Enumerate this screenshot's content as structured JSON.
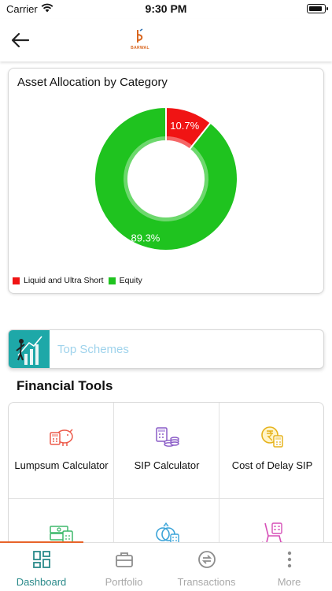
{
  "status": {
    "carrier": "Carrier",
    "time": "9:30 PM"
  },
  "header": {
    "logo_text": "BARWAL",
    "back_icon": "arrow-left-icon"
  },
  "chart_card": {
    "title": "Asset Allocation by Category"
  },
  "chart_data": {
    "type": "pie",
    "title": "Asset Allocation by Category",
    "categories": [
      "Liquid and Ultra Short",
      "Equity"
    ],
    "values": [
      10.7,
      89.3
    ],
    "labels": [
      "10.7%",
      "89.3%"
    ],
    "colors": [
      "#f01414",
      "#1fc31f"
    ],
    "legend_position": "bottom-left"
  },
  "schemes": {
    "label": "Top Schemes",
    "icon": "chart-growth-icon"
  },
  "tools": {
    "title": "Financial Tools",
    "items": [
      {
        "label": "Lumpsum Calculator",
        "icon": "piggy-bank-calculator-icon"
      },
      {
        "label": "SIP Calculator",
        "icon": "coins-calculator-icon"
      },
      {
        "label": "Cost of Delay SIP",
        "icon": "rupee-coin-calculator-icon"
      },
      {
        "label": "",
        "icon": "money-calculator-icon"
      },
      {
        "label": "",
        "icon": "rings-calculator-icon"
      },
      {
        "label": "",
        "icon": "rocking-chair-icon"
      }
    ]
  },
  "tabs": [
    {
      "label": "Dashboard",
      "icon": "dashboard-grid-icon",
      "active": true
    },
    {
      "label": "Portfolio",
      "icon": "briefcase-icon",
      "active": false
    },
    {
      "label": "Transactions",
      "icon": "exchange-icon",
      "active": false
    },
    {
      "label": "More",
      "icon": "more-vertical-icon",
      "active": false
    }
  ],
  "colors": {
    "accent": "#e8642a",
    "teal": "#2a8a8a",
    "equity": "#1fc31f",
    "liquid": "#f01414"
  }
}
